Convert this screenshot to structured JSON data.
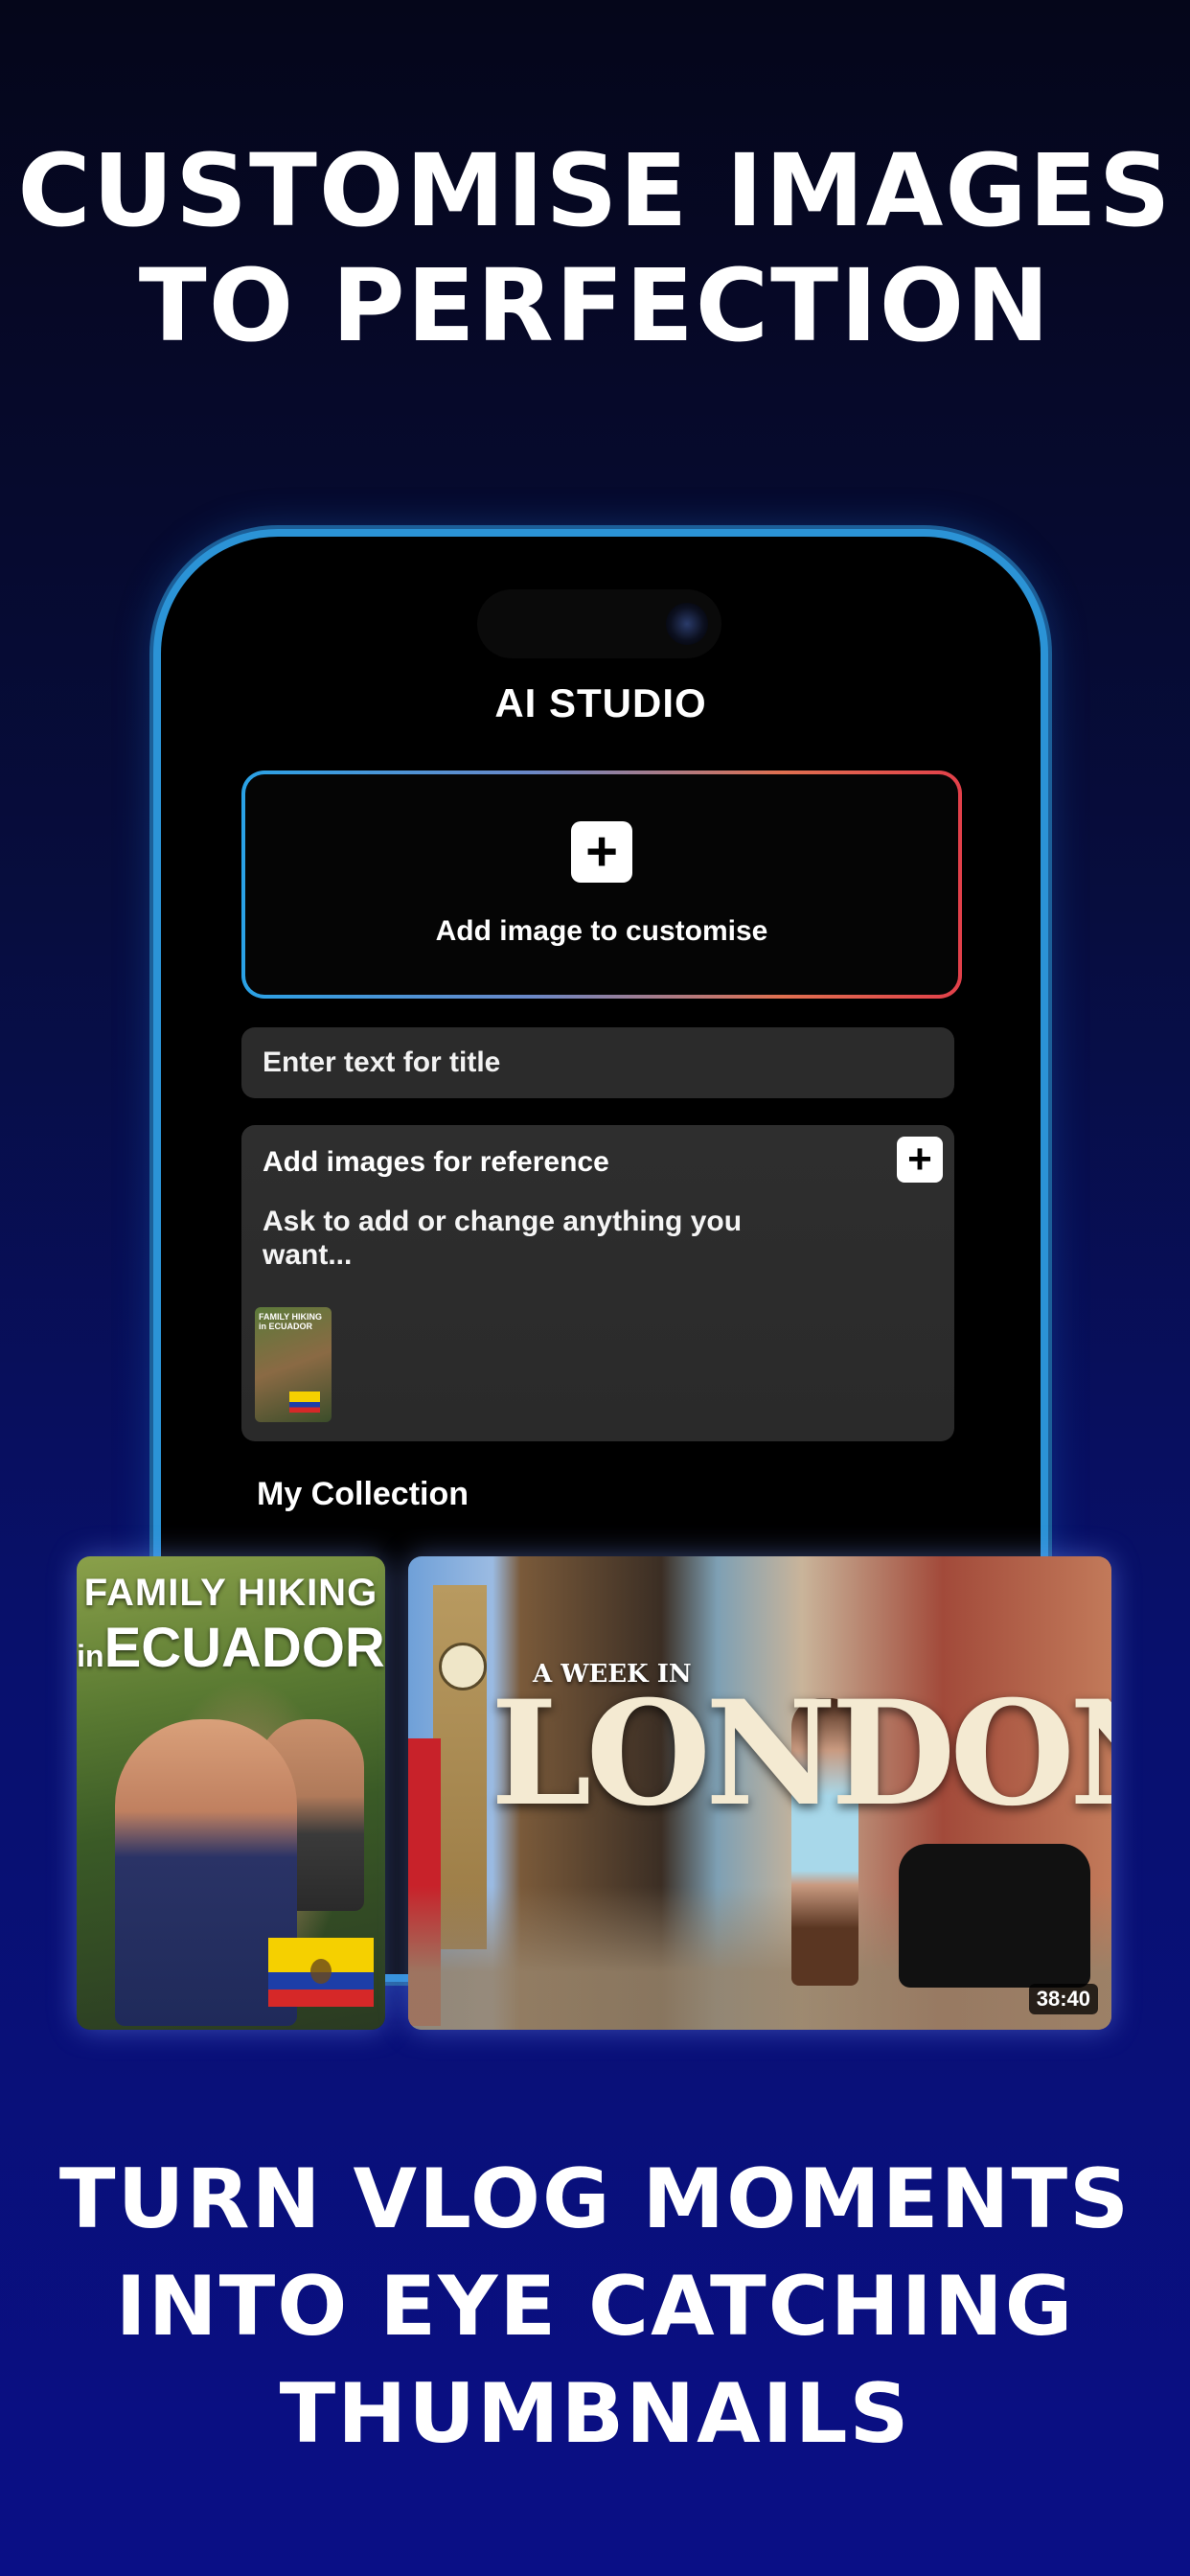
{
  "headline_top": [
    "CUSTOMISE IMAGES",
    "TO PERFECTION"
  ],
  "headline_bottom": [
    "TURN VLOG MOMENTS",
    "INTO EYE CATCHING",
    "THUMBNAILS"
  ],
  "colors": {
    "phone_frame": "#2b93d6",
    "background_bottom": "#0a0f86",
    "gradient_start": "#2aa2e6",
    "gradient_end": "#e2404a"
  },
  "app": {
    "title": "AI STUDIO",
    "add_image": {
      "icon": "plus-icon",
      "label": "Add image to customise"
    },
    "title_field": {
      "placeholder": "Enter text for title"
    },
    "reference": {
      "title": "Add images for reference",
      "icon": "plus-icon",
      "prompt_placeholder": "Ask to add or change anything you want...",
      "thumbnail_text": "FAMILY HIKING in ECUADOR"
    },
    "collection_label": "My Collection"
  },
  "thumbnails": [
    {
      "title_line1": "FAMILY HIKING",
      "title_small": "in",
      "title_line2": "ECUADOR"
    },
    {
      "subtitle": "A WEEK IN",
      "title": "LONDON",
      "duration": "38:40"
    }
  ]
}
